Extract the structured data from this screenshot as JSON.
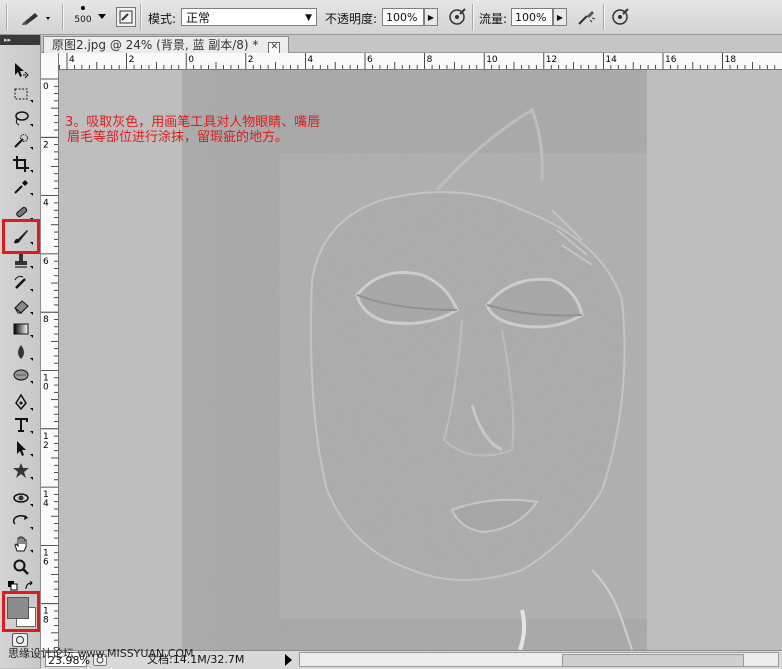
{
  "options_bar": {
    "brush_size": "500",
    "mode_label": "模式:",
    "mode_value": "正常",
    "opacity_label": "不透明度:",
    "opacity_value": "100%",
    "flow_label": "流量:",
    "flow_value": "100%"
  },
  "document": {
    "tab_title": "原图2.jpg @ 24% (背景, 蓝 副本/8) *",
    "close_glyph": "✕",
    "annotation_line1": "3。吸取灰色，用画笔工具对人物眼睛、嘴唇",
    "annotation_line2": "眉毛等部位进行涂抹，留瑕疵的地方。"
  },
  "rulers": {
    "horizontal_labels": [
      "4",
      "2",
      "0",
      "2",
      "4",
      "6",
      "8",
      "10",
      "12",
      "14",
      "16",
      "18"
    ],
    "vertical_labels": [
      "0",
      "2",
      "4",
      "6",
      "8",
      "1\n0",
      "1\n2",
      "1\n4",
      "1\n6",
      "1\n8"
    ]
  },
  "status_bar": {
    "zoom": "23.98%",
    "doc_info": "文档:14.1M/32.7M"
  },
  "watermark": "思缘设计论坛 www.MISSYUAN.COM",
  "colors": {
    "highlight_red": "#e01b1b",
    "foreground_swatch": "#8c8c8c",
    "background_swatch": "#ffffff",
    "photo_gray": "#a9a9a9"
  },
  "icons": {
    "tools": [
      "move-icon",
      "marquee-icon",
      "lasso-icon",
      "quick-select-icon",
      "crop-icon",
      "eyedropper-icon",
      "spot-heal-icon",
      "brush-icon",
      "stamp-icon",
      "history-brush-icon",
      "eraser-icon",
      "gradient-icon",
      "blur-icon",
      "dodge-icon",
      "pen-icon",
      "type-icon",
      "path-select-icon",
      "shape-icon",
      "3d-rotate-icon",
      "3d-orbit-icon",
      "hand-icon",
      "zoom-icon"
    ]
  }
}
